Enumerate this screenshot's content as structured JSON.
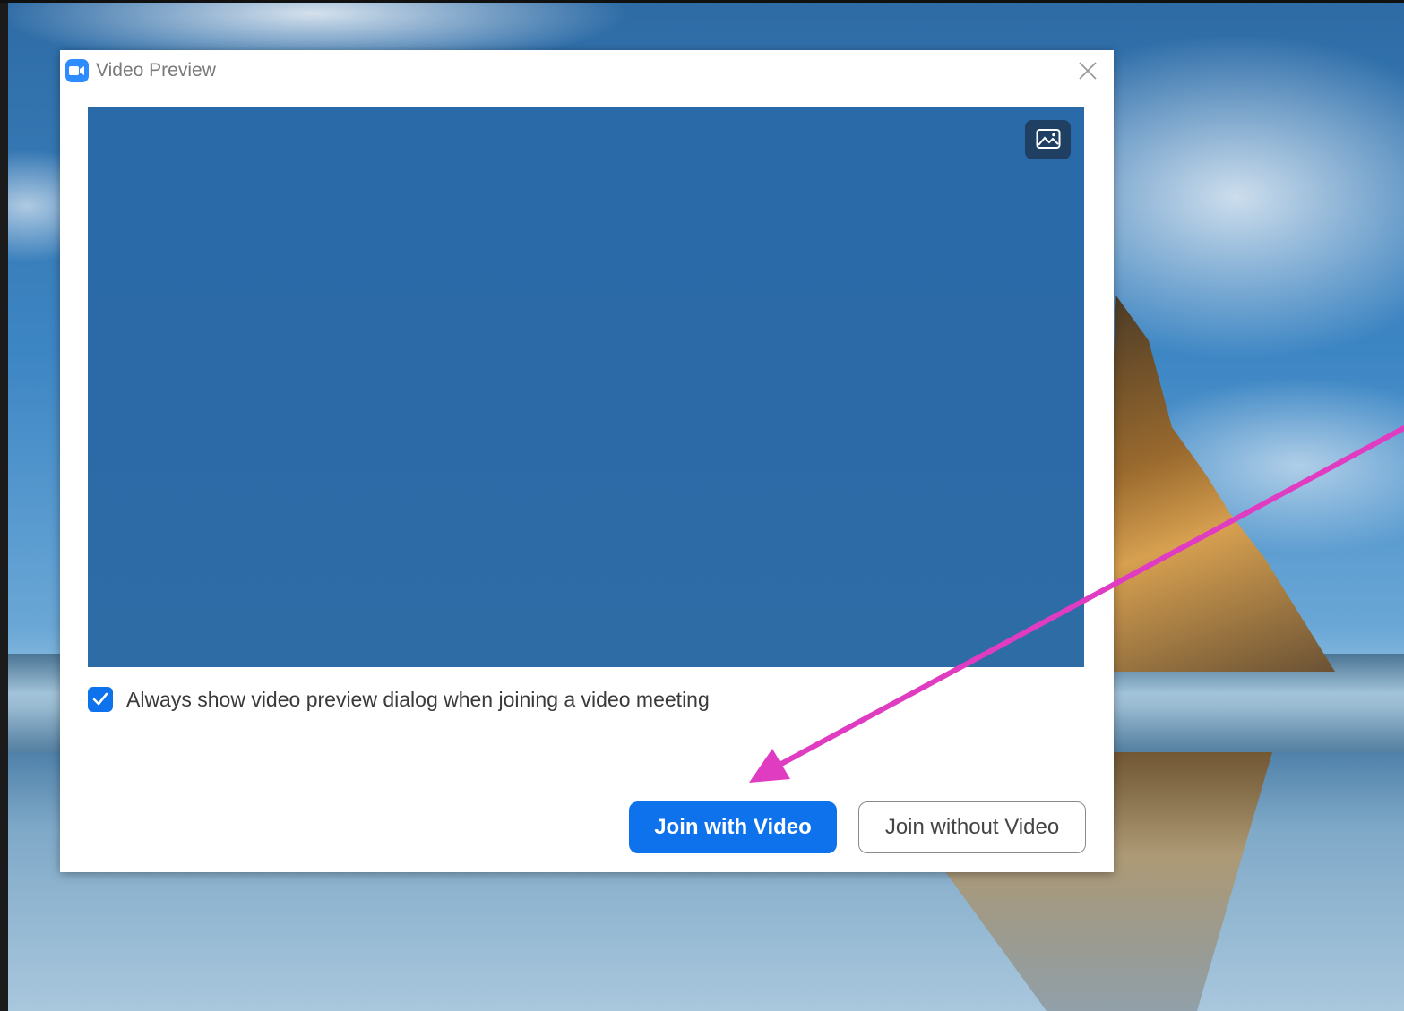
{
  "dialog": {
    "title": "Video Preview",
    "checkbox": {
      "label": "Always show video preview dialog when joining a video meeting",
      "checked": true
    },
    "buttons": {
      "join_with_video": "Join with Video",
      "join_without_video": "Join without Video"
    },
    "icons": {
      "app": "zoom-camera-icon",
      "close": "close-icon",
      "background": "image-icon"
    }
  },
  "colors": {
    "accent": "#0e72ed",
    "preview_bg": "#2b6aa7",
    "annotation_arrow": "#e03cc2"
  }
}
